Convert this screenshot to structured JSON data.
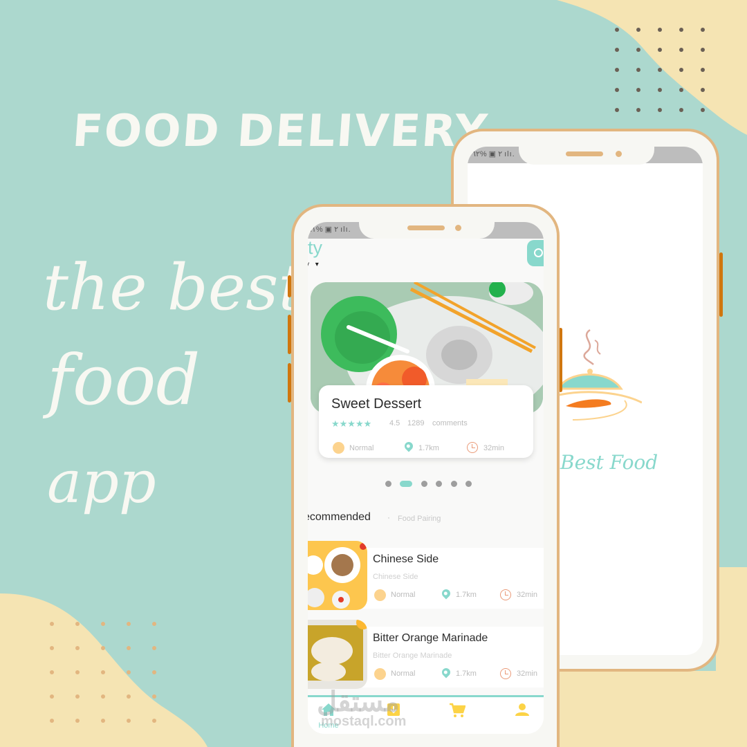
{
  "colors": {
    "background_teal": "#acd8ce",
    "background_cream": "#f5e4b3",
    "accent_teal": "#88d8cc",
    "frame_tan": "#e2b680",
    "button_orange": "#d0760e",
    "dot_dark": "#6b6055",
    "dot_tan": "#e2b680"
  },
  "poster": {
    "headline": "FOOD DELIVERY",
    "script_lines": [
      "the best",
      "food",
      "app"
    ]
  },
  "back_phone": {
    "status_bar": "٢ ▣ %٦٢ ılı.",
    "splash_logo": "cloche-icon",
    "brand_name": "Best Food"
  },
  "front_phone": {
    "status_bar": "٢ ▣ %٦١ ılı.",
    "header": {
      "location_title": "ity",
      "location_sub": "y",
      "search_icon": "search-icon"
    },
    "featured": {
      "title": "Sweet Dessert",
      "stars": "★★★★★",
      "rating": "4.5",
      "comments_count": "1289",
      "comments_label": "comments",
      "level": "Normal",
      "distance": "1.7km",
      "time": "32min"
    },
    "pager": {
      "total": 6,
      "active_index": 1
    },
    "recommended": {
      "title": "ecommended",
      "separator": "·",
      "subtitle": "Food Pairing",
      "items": [
        {
          "title": "Chinese Side",
          "subtitle": "Chinese Side",
          "level": "Normal",
          "distance": "1.7km",
          "time": "32min"
        },
        {
          "title": "Bitter Orange Marinade",
          "subtitle": "Bitter Orange Marinade",
          "level": "Normal",
          "distance": "1.7km",
          "time": "32min"
        }
      ]
    },
    "tabbar": {
      "tabs": [
        {
          "label": "Home",
          "icon": "home-icon",
          "active": true
        },
        {
          "label": "",
          "icon": "orders-icon",
          "active": false
        },
        {
          "label": "",
          "icon": "cart-icon",
          "active": false
        },
        {
          "label": "",
          "icon": "profile-icon",
          "active": false
        }
      ]
    }
  },
  "watermark": {
    "arabic": "مستقل",
    "latin": "mostaql.com"
  }
}
